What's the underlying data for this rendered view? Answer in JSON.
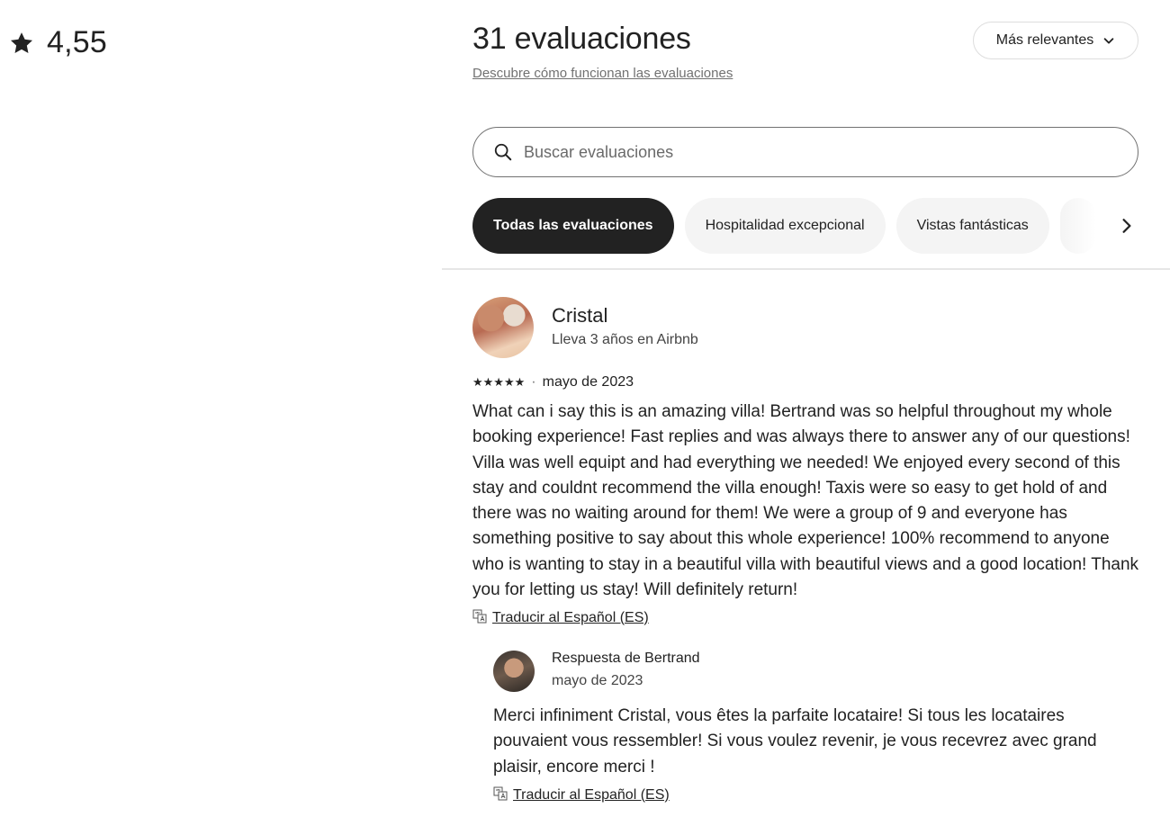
{
  "overall": {
    "rating": "4,55",
    "icon": "star-icon"
  },
  "header": {
    "title": "31 evaluaciones",
    "how_link": "Descubre cómo funcionan las evaluaciones",
    "sort_label": "Más relevantes"
  },
  "search": {
    "placeholder": "Buscar evaluaciones",
    "value": ""
  },
  "filters": [
    {
      "label": "Todas las evaluaciones",
      "active": true
    },
    {
      "label": "Hospitalidad excepcional",
      "active": false
    },
    {
      "label": "Vistas fantásticas",
      "active": false
    }
  ],
  "review": {
    "name": "Cristal",
    "meta": "Lleva 3 años en Airbnb",
    "stars": "★★★★★",
    "separator": "·",
    "date": "mayo de 2023",
    "text": "What can i say this is an amazing villa! Bertrand was so helpful throughout my whole booking experience! Fast replies and was always there to answer any of our questions! Villa was well equipt and had everything we needed! We enjoyed every second of this stay and couldnt recommend the villa enough! Taxis were so easy to get hold of and there was no waiting around for them! We were a group of 9 and everyone has something positive to say about this whole experience! 100% recommend to anyone who is wanting to stay in a beautiful villa with beautiful views and a good location!  Thank you for letting us stay! Will definitely return!",
    "translate_label": "Traducir al Español (ES)"
  },
  "host_response": {
    "title": "Respuesta de Bertrand",
    "date": "mayo de 2023",
    "text": "Merci infiniment Cristal, vous êtes la parfaite locataire! Si tous les locataires pouvaient vous ressembler! Si vous voulez revenir, je vous recevrez avec grand plaisir, encore merci !",
    "translate_label": "Traducir al Español (ES)"
  },
  "colors": {
    "text": "#222222",
    "muted": "#717171",
    "active_chip": "#222222",
    "chip_bg": "#f4f4f4"
  }
}
